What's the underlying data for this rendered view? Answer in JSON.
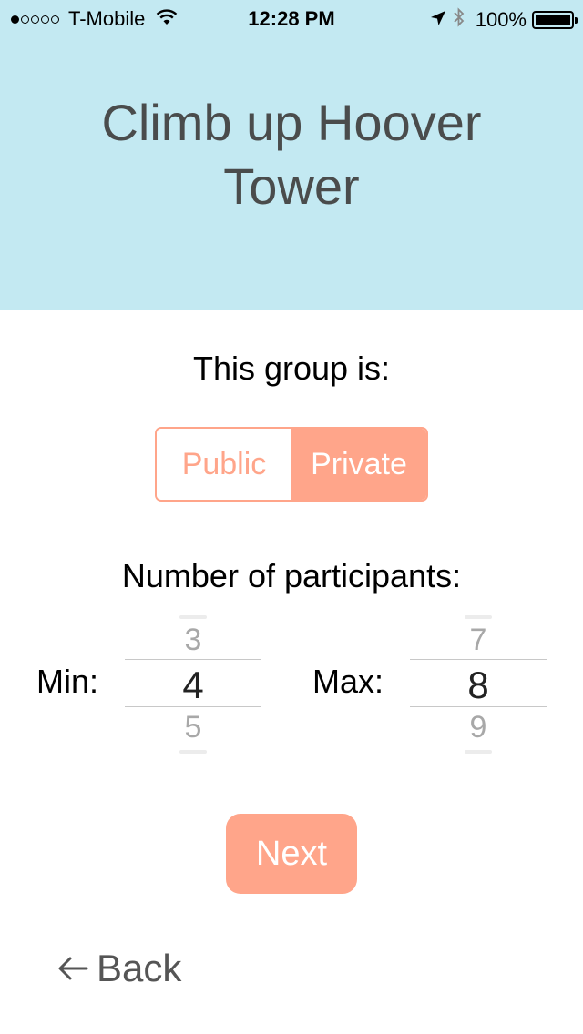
{
  "status_bar": {
    "carrier": "T-Mobile",
    "time": "12:28 PM",
    "battery_percent": "100%",
    "signal_bars_filled": 1,
    "signal_bars_total": 5
  },
  "header": {
    "title": "Climb up Hoover Tower",
    "background": "#c3e9f2"
  },
  "privacy": {
    "label": "This group is:",
    "options": [
      "Public",
      "Private"
    ],
    "selected": "Private"
  },
  "participants": {
    "label": "Number of participants:",
    "min": {
      "label": "Min:",
      "previous": "3",
      "value": "4",
      "next": "5"
    },
    "max": {
      "label": "Max:",
      "previous": "7",
      "value": "8",
      "next": "9"
    }
  },
  "actions": {
    "next_label": "Next",
    "back_label": "Back"
  },
  "colors": {
    "accent": "#ffa58a",
    "title_text": "#4a4c4c"
  }
}
